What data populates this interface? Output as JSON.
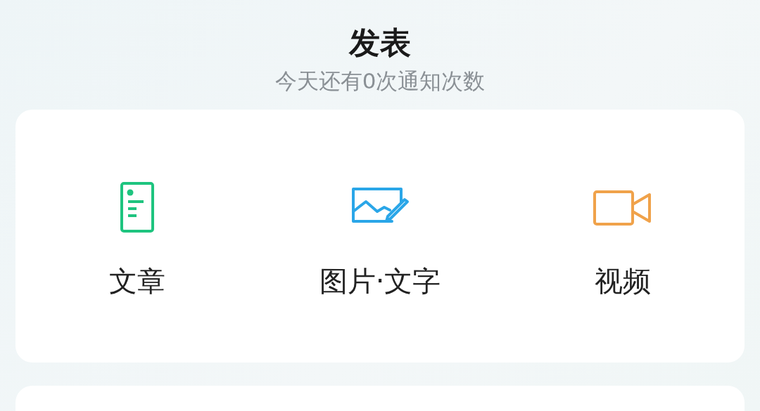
{
  "header": {
    "title": "发表",
    "subtitle": "今天还有0次通知次数"
  },
  "options": [
    {
      "kind": "article",
      "label": "文章"
    },
    {
      "kind": "image",
      "label": "图片·文字"
    },
    {
      "kind": "video",
      "label": "视频"
    }
  ]
}
